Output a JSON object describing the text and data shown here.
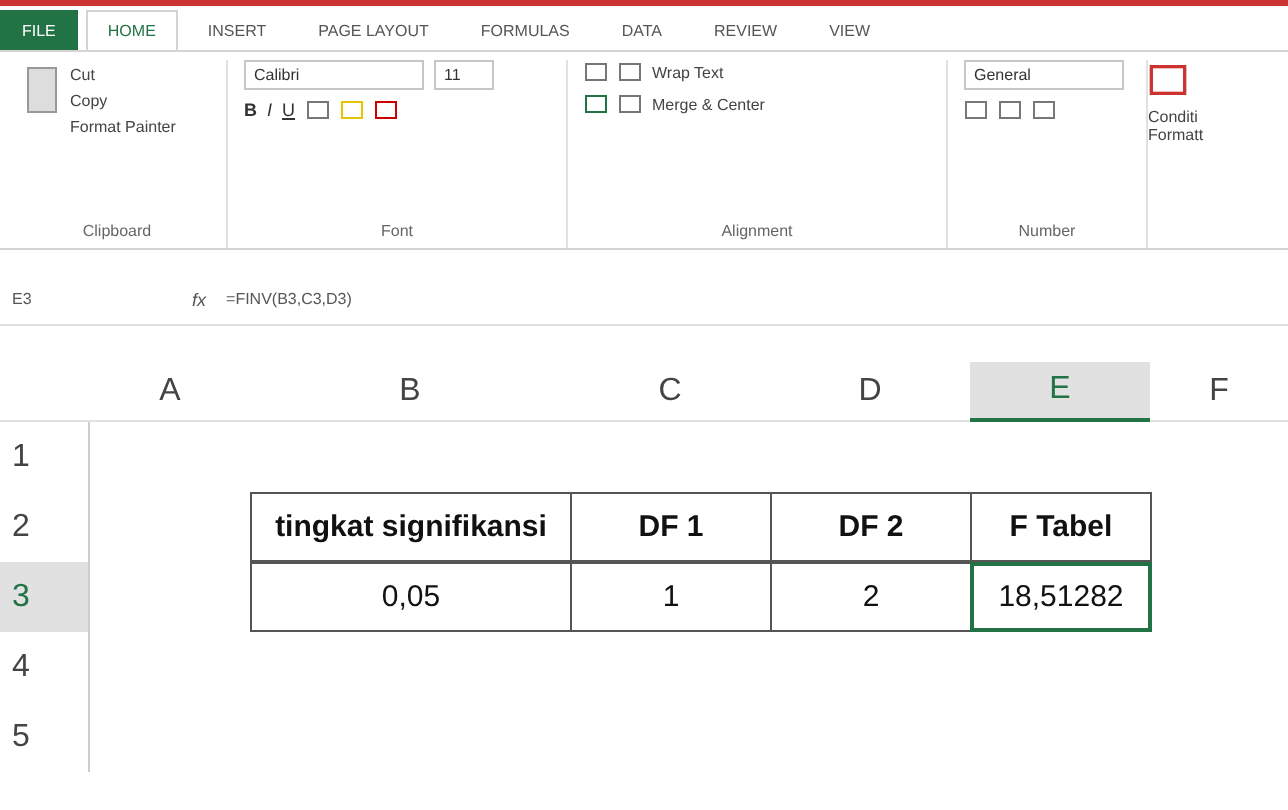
{
  "tabs": [
    {
      "label": "FILE",
      "kind": "file",
      "selected": false
    },
    {
      "label": "HOME",
      "kind": "tab",
      "selected": true
    },
    {
      "label": "INSERT",
      "kind": "tab",
      "selected": false
    },
    {
      "label": "PAGE LAYOUT",
      "kind": "tab",
      "selected": false
    },
    {
      "label": "FORMULAS",
      "kind": "tab",
      "selected": false
    },
    {
      "label": "DATA",
      "kind": "tab",
      "selected": false
    },
    {
      "label": "REVIEW",
      "kind": "tab",
      "selected": false
    },
    {
      "label": "VIEW",
      "kind": "tab",
      "selected": false
    }
  ],
  "clipboard": {
    "label": "Clipboard",
    "cut": "Cut",
    "copy": "Copy",
    "format_painter": "Format Painter"
  },
  "font": {
    "label": "Font",
    "name": "Calibri",
    "size": "11",
    "bold": "B",
    "italic": "I",
    "underline": "U"
  },
  "alignment": {
    "label": "Alignment",
    "wrap": "Wrap Text",
    "merge": "Merge & Center"
  },
  "number": {
    "label": "Number",
    "format": "General"
  },
  "styles": {
    "label_line_1": "Conditi",
    "label_line_2": "Formatt"
  },
  "formula_bar": {
    "name_box": "E3",
    "fx": "fx",
    "formula": "=FINV(B3,C3,D3)"
  },
  "columns": [
    {
      "label": "A",
      "selected": false
    },
    {
      "label": "B",
      "selected": false
    },
    {
      "label": "C",
      "selected": false
    },
    {
      "label": "D",
      "selected": false
    },
    {
      "label": "E",
      "selected": true
    },
    {
      "label": "F",
      "selected": false
    }
  ],
  "rows": [
    {
      "label": "1",
      "selected": false
    },
    {
      "label": "2",
      "selected": false,
      "cells": [
        {
          "text": "tingkat signifikansi",
          "bold": true
        },
        {
          "text": "DF 1",
          "bold": true
        },
        {
          "text": "DF 2",
          "bold": true
        },
        {
          "text": "F Tabel",
          "bold": true
        }
      ]
    },
    {
      "label": "3",
      "selected": true,
      "cells": [
        {
          "text": "0,05",
          "bold": false
        },
        {
          "text": "1",
          "bold": false
        },
        {
          "text": "2",
          "bold": false
        },
        {
          "text": "18,51282",
          "bold": false,
          "active": true
        }
      ]
    },
    {
      "label": "4",
      "selected": false
    },
    {
      "label": "5",
      "selected": false
    }
  ]
}
